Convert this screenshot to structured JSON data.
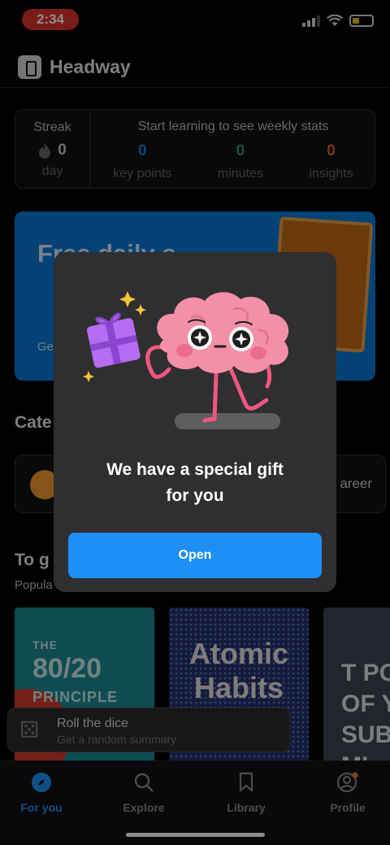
{
  "status_bar": {
    "time": "2:34"
  },
  "header": {
    "app_name": "Headway"
  },
  "stats": {
    "streak_label": "Streak",
    "streak_value": "0",
    "streak_unit": "day",
    "weekly_title": "Start learning to see weekly stats",
    "key_points": {
      "value": "0",
      "label": "key points",
      "color": "#1e7fd6"
    },
    "minutes": {
      "value": "0",
      "label": "minutes",
      "color": "#1f9d6b"
    },
    "insights": {
      "value": "0",
      "label": "insights",
      "color": "#d2692a"
    }
  },
  "promo": {
    "title": "Free daily s",
    "subtitle": "Ge"
  },
  "categories": {
    "title": "Cate",
    "career_label": "areer"
  },
  "to_go": {
    "title": "To g",
    "subtitle": "Popula"
  },
  "books": [
    {
      "line1": "THE",
      "line2": "80/20",
      "line3": "PRINCIPLE"
    },
    {
      "title": "Atomic Habits"
    },
    {
      "title": "T POW OF Y SUBCO MI"
    }
  ],
  "dice": {
    "title": "Roll the dice",
    "subtitle": "Get a random summary"
  },
  "nav": {
    "items": [
      {
        "label": "For you",
        "active": true
      },
      {
        "label": "Explore",
        "active": false
      },
      {
        "label": "Library",
        "active": false
      },
      {
        "label": "Profile",
        "active": false
      }
    ],
    "active_color": "#1e90f5",
    "inactive_color": "#8a8a8e"
  },
  "dialog": {
    "heading": "We have a special gift\nfor you",
    "open_label": "Open"
  }
}
